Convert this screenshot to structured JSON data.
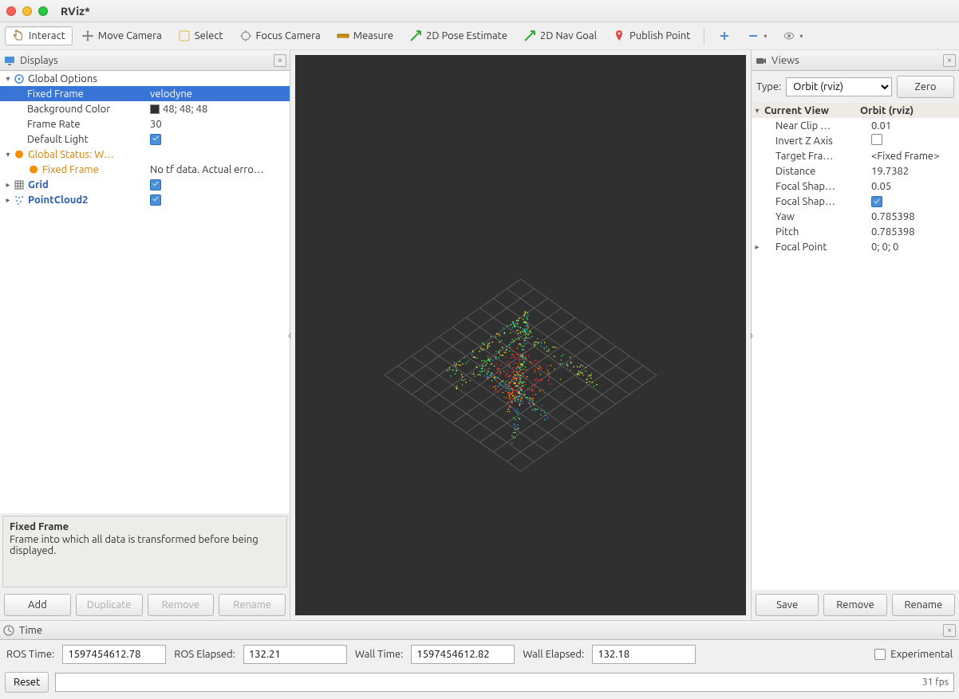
{
  "window": {
    "title": "RViz*"
  },
  "toolbar": {
    "interact": "Interact",
    "move_camera": "Move Camera",
    "select": "Select",
    "focus_camera": "Focus Camera",
    "measure": "Measure",
    "pose_estimate": "2D Pose Estimate",
    "nav_goal": "2D Nav Goal",
    "publish_point": "Publish Point"
  },
  "displays": {
    "title": "Displays",
    "global_options": {
      "label": "Global Options",
      "fixed_frame": {
        "label": "Fixed Frame",
        "value": "velodyne"
      },
      "background_color": {
        "label": "Background Color",
        "value": "48; 48; 48"
      },
      "frame_rate": {
        "label": "Frame Rate",
        "value": "30"
      },
      "default_light": {
        "label": "Default Light",
        "checked": true
      }
    },
    "global_status": {
      "label": "Global Status: W…",
      "fixed_frame": {
        "label": "Fixed Frame",
        "value": "No tf data.  Actual erro…"
      }
    },
    "grid": {
      "label": "Grid",
      "checked": true
    },
    "pointcloud2": {
      "label": "PointCloud2",
      "checked": true
    },
    "description": {
      "title": "Fixed Frame",
      "body": "Frame into which all data is transformed before being displayed."
    },
    "buttons": {
      "add": "Add",
      "duplicate": "Duplicate",
      "remove": "Remove",
      "rename": "Rename"
    }
  },
  "views": {
    "title": "Views",
    "type_label": "Type:",
    "type_value": "Orbit (rviz)",
    "zero": "Zero",
    "current_view": {
      "label": "Current View",
      "value": "Orbit (rviz)"
    },
    "near_clip": {
      "label": "Near Clip …",
      "value": "0.01"
    },
    "invert_z": {
      "label": "Invert Z Axis",
      "checked": false
    },
    "target_frame": {
      "label": "Target Fra…",
      "value": "<Fixed Frame>"
    },
    "distance": {
      "label": "Distance",
      "value": "19.7382"
    },
    "focal_shape_size": {
      "label": "Focal Shap…",
      "value": "0.05"
    },
    "focal_shape_fixed": {
      "label": "Focal Shap…",
      "checked": true
    },
    "yaw": {
      "label": "Yaw",
      "value": "0.785398"
    },
    "pitch": {
      "label": "Pitch",
      "value": "0.785398"
    },
    "focal_point": {
      "label": "Focal Point",
      "value": "0; 0; 0"
    },
    "buttons": {
      "save": "Save",
      "remove": "Remove",
      "rename": "Rename"
    }
  },
  "time": {
    "title": "Time",
    "ros_time_label": "ROS Time:",
    "ros_time": "1597454612.78",
    "ros_elapsed_label": "ROS Elapsed:",
    "ros_elapsed": "132.21",
    "wall_time_label": "Wall Time:",
    "wall_time": "1597454612.82",
    "wall_elapsed_label": "Wall Elapsed:",
    "wall_elapsed": "132.18",
    "experimental": "Experimental",
    "reset": "Reset",
    "fps": "31 fps"
  }
}
